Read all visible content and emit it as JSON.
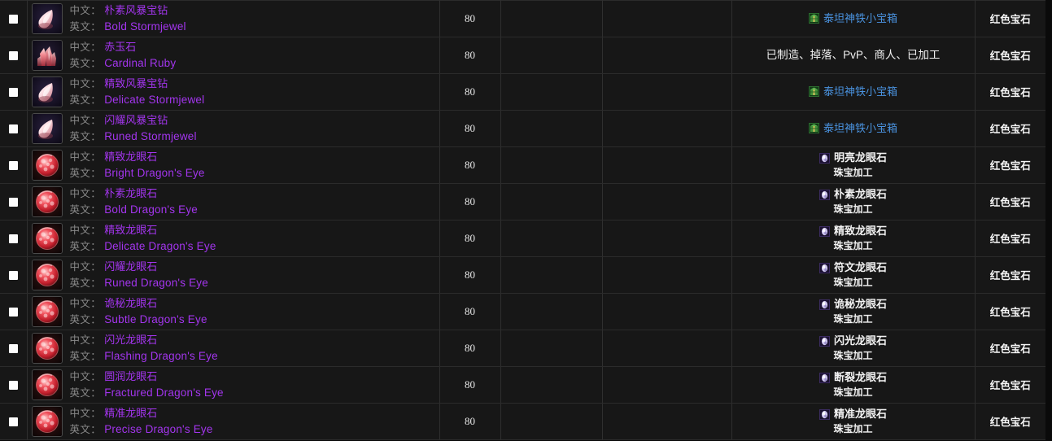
{
  "table": {
    "columns": {
      "checkbox": "",
      "item": "",
      "level": "",
      "blank_b": "",
      "blank_c": "",
      "source": "",
      "type": ""
    },
    "labels": {
      "cn": "中文：",
      "en": "英文："
    },
    "rows": [
      {
        "icon": "teardrop-white-gem-icon",
        "icon_style": "teardrop-white",
        "cn_name": "朴素风暴宝钻",
        "en_name": "Bold Stormjewel",
        "level": "80",
        "b": "",
        "c": "",
        "source_kind": "chest",
        "source_icon": "green-chest-icon",
        "source_name": "泰坦神铁小宝箱",
        "source_sub": "",
        "type": "红色宝石"
      },
      {
        "icon": "red-crystal-cluster-icon",
        "icon_style": "crystal-red",
        "cn_name": "赤玉石",
        "en_name": "Cardinal Ruby",
        "level": "80",
        "b": "",
        "c": "",
        "source_kind": "plain",
        "source_icon": "",
        "source_name": "已制造、掉落、PvP、商人、已加工",
        "source_sub": "",
        "type": "红色宝石"
      },
      {
        "icon": "teardrop-white-gem-icon",
        "icon_style": "teardrop-white",
        "cn_name": "精致风暴宝钻",
        "en_name": "Delicate Stormjewel",
        "level": "80",
        "b": "",
        "c": "",
        "source_kind": "chest",
        "source_icon": "green-chest-icon",
        "source_name": "泰坦神铁小宝箱",
        "source_sub": "",
        "type": "红色宝石"
      },
      {
        "icon": "teardrop-white-gem-icon",
        "icon_style": "teardrop-white",
        "cn_name": "闪耀风暴宝钻",
        "en_name": "Runed Stormjewel",
        "level": "80",
        "b": "",
        "c": "",
        "source_kind": "chest",
        "source_icon": "green-chest-icon",
        "source_name": "泰坦神铁小宝箱",
        "source_sub": "",
        "type": "红色宝石"
      },
      {
        "icon": "round-red-gem-icon",
        "icon_style": "round-red",
        "cn_name": "精致龙眼石",
        "en_name": "Bright Dragon's Eye",
        "level": "80",
        "b": "",
        "c": "",
        "source_kind": "item",
        "source_icon": "purple-gem-icon",
        "source_name": "明亮龙眼石",
        "source_sub": "珠宝加工",
        "type": "红色宝石"
      },
      {
        "icon": "round-red-gem-icon",
        "icon_style": "round-red",
        "cn_name": "朴素龙眼石",
        "en_name": "Bold Dragon's Eye",
        "level": "80",
        "b": "",
        "c": "",
        "source_kind": "item",
        "source_icon": "purple-gem-icon",
        "source_name": "朴素龙眼石",
        "source_sub": "珠宝加工",
        "type": "红色宝石"
      },
      {
        "icon": "round-red-gem-icon",
        "icon_style": "round-red",
        "cn_name": "精致龙眼石",
        "en_name": "Delicate Dragon's Eye",
        "level": "80",
        "b": "",
        "c": "",
        "source_kind": "item",
        "source_icon": "purple-gem-icon",
        "source_name": "精致龙眼石",
        "source_sub": "珠宝加工",
        "type": "红色宝石"
      },
      {
        "icon": "round-red-gem-icon",
        "icon_style": "round-red",
        "cn_name": "闪耀龙眼石",
        "en_name": "Runed Dragon's Eye",
        "level": "80",
        "b": "",
        "c": "",
        "source_kind": "item",
        "source_icon": "purple-gem-icon",
        "source_name": "符文龙眼石",
        "source_sub": "珠宝加工",
        "type": "红色宝石"
      },
      {
        "icon": "round-red-gem-icon",
        "icon_style": "round-red",
        "cn_name": "诡秘龙眼石",
        "en_name": "Subtle Dragon's Eye",
        "level": "80",
        "b": "",
        "c": "",
        "source_kind": "item",
        "source_icon": "purple-gem-icon",
        "source_name": "诡秘龙眼石",
        "source_sub": "珠宝加工",
        "type": "红色宝石"
      },
      {
        "icon": "round-red-gem-icon",
        "icon_style": "round-red",
        "cn_name": "闪光龙眼石",
        "en_name": "Flashing Dragon's Eye",
        "level": "80",
        "b": "",
        "c": "",
        "source_kind": "item",
        "source_icon": "purple-gem-icon",
        "source_name": "闪光龙眼石",
        "source_sub": "珠宝加工",
        "type": "红色宝石"
      },
      {
        "icon": "round-red-gem-icon",
        "icon_style": "round-red",
        "cn_name": "圆润龙眼石",
        "en_name": "Fractured Dragon's Eye",
        "level": "80",
        "b": "",
        "c": "",
        "source_kind": "item",
        "source_icon": "purple-gem-icon",
        "source_name": "断裂龙眼石",
        "source_sub": "珠宝加工",
        "type": "红色宝石"
      },
      {
        "icon": "round-red-gem-icon",
        "icon_style": "round-red",
        "cn_name": "精准龙眼石",
        "en_name": "Precise Dragon's Eye",
        "level": "80",
        "b": "",
        "c": "",
        "source_kind": "item",
        "source_icon": "purple-gem-icon",
        "source_name": "精准龙眼石",
        "source_sub": "珠宝加工",
        "type": "红色宝石"
      }
    ]
  },
  "colors": {
    "epic_link": "#a335ee",
    "chest_link": "#4a93e0",
    "label_gray": "#8a8a8a",
    "row_bg": "#171717",
    "border": "#2f2f2f"
  }
}
